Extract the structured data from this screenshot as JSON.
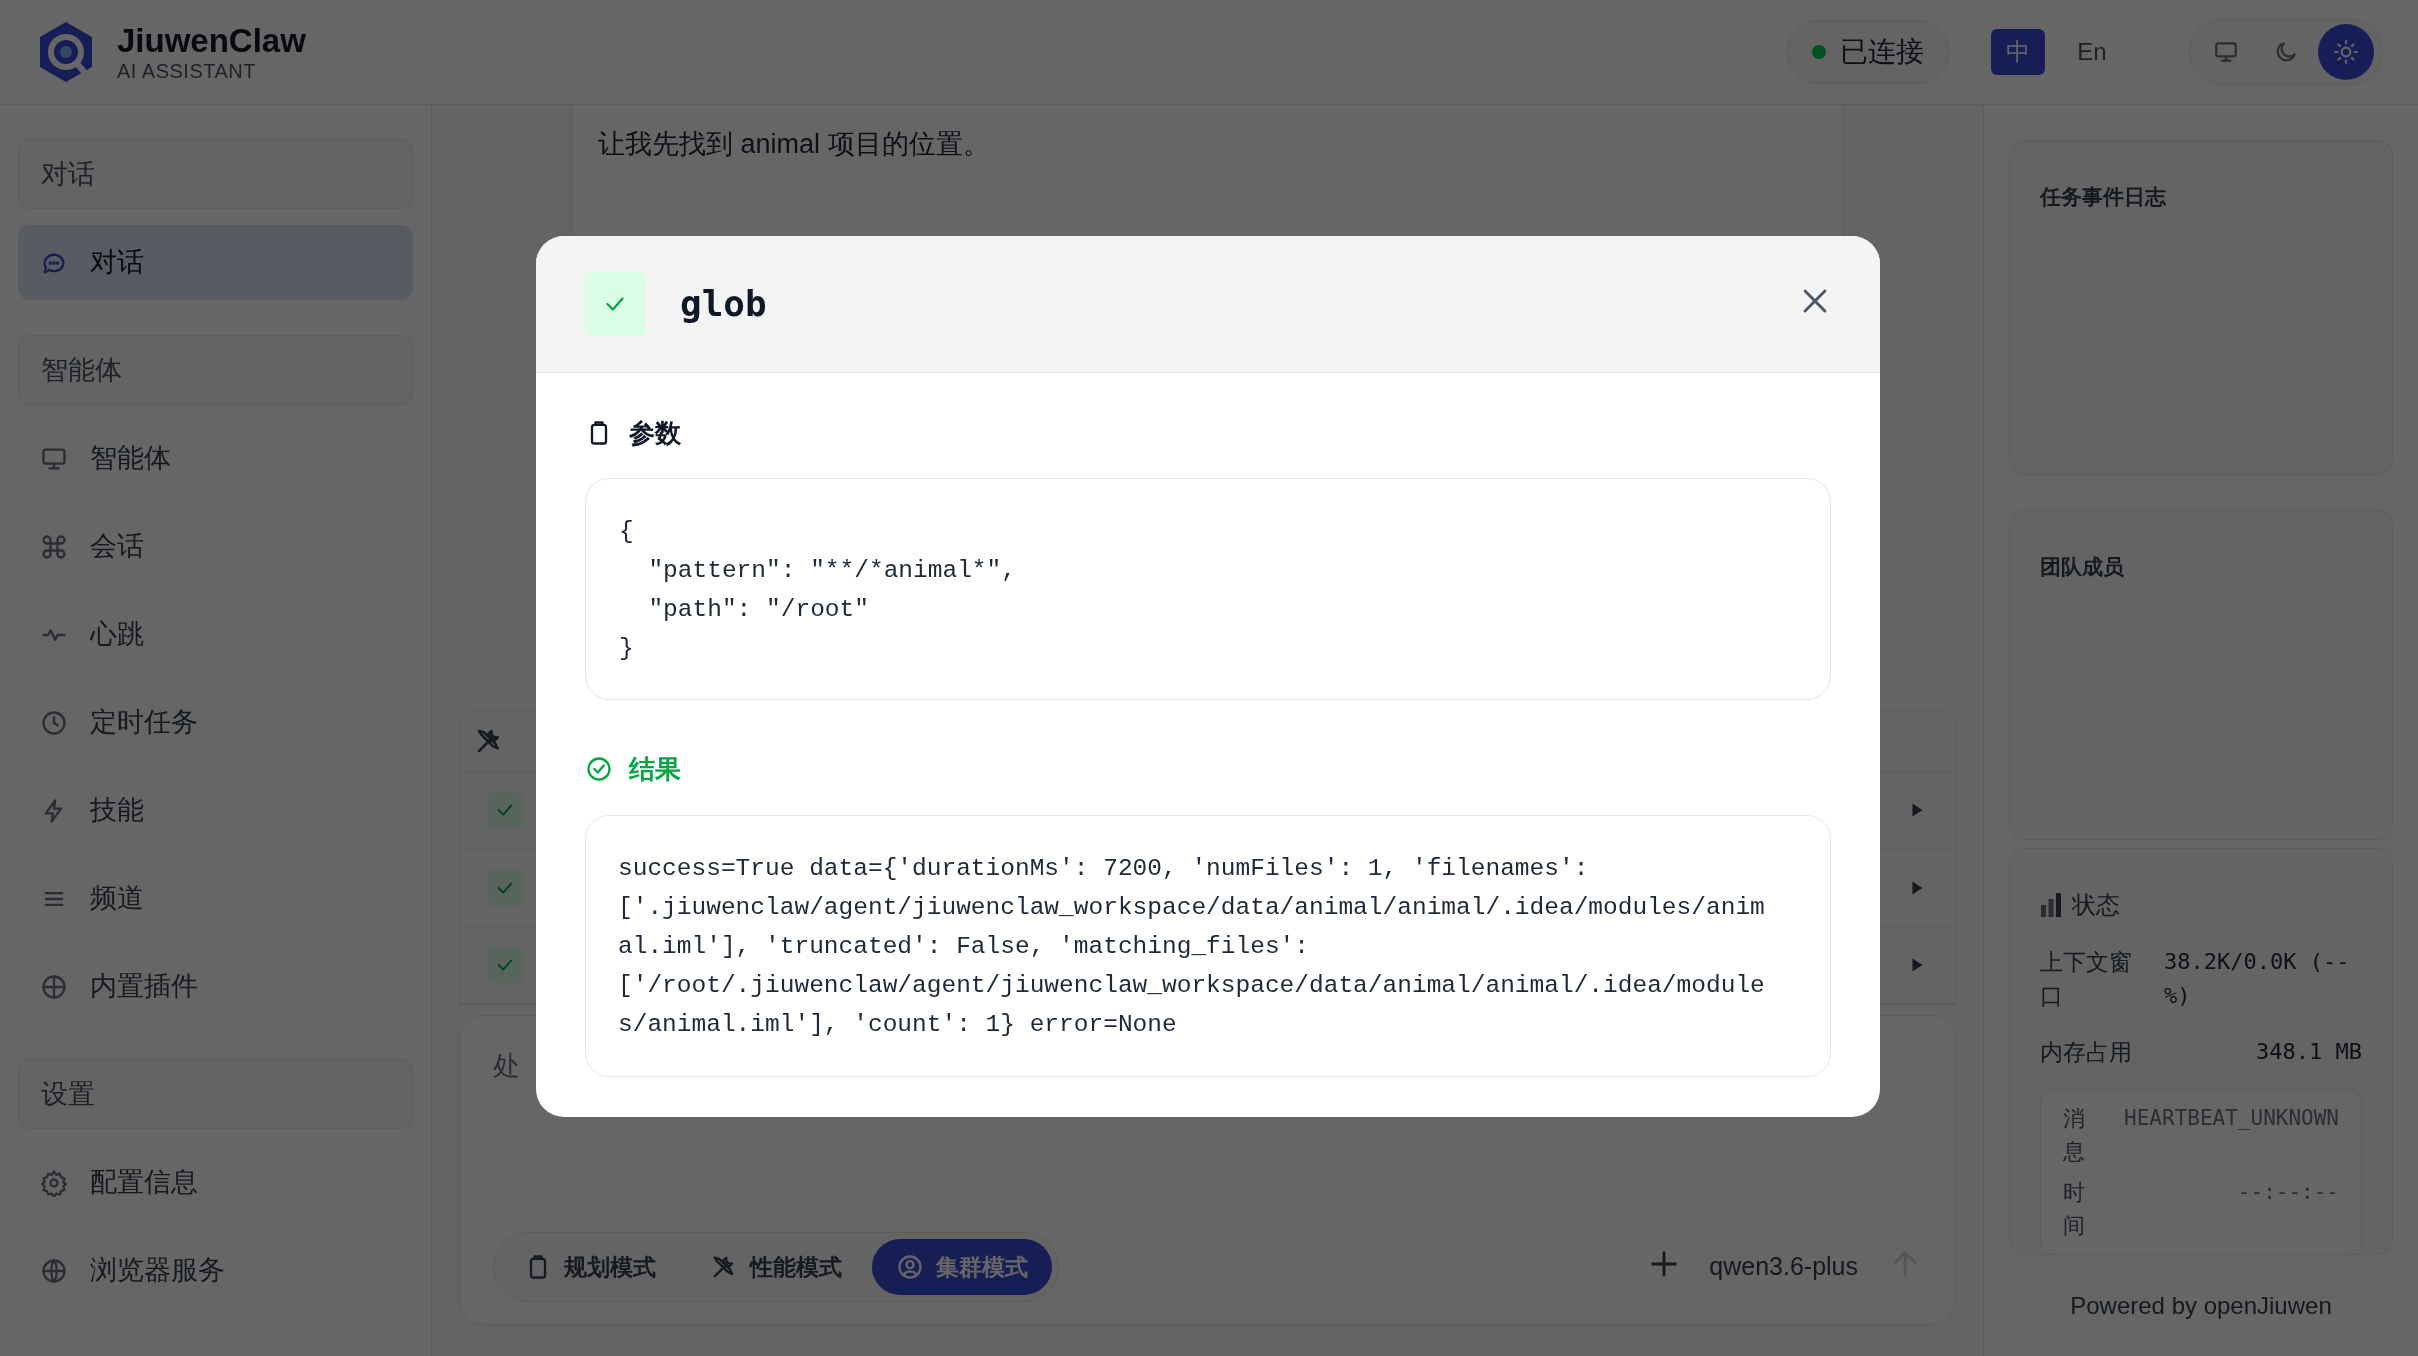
{
  "header": {
    "app_name": "JiuwenClaw",
    "app_subtitle": "AI ASSISTANT",
    "connection": {
      "label": "已连接",
      "connected": true
    },
    "languages": [
      {
        "label": "中",
        "selected": true
      },
      {
        "label": "En",
        "selected": false
      }
    ],
    "themes": [
      {
        "kind": "monitor",
        "selected": false
      },
      {
        "kind": "moon",
        "selected": false
      },
      {
        "kind": "sun",
        "selected": true
      }
    ]
  },
  "sidebar": {
    "sections": [
      {
        "title": "对话",
        "items": [
          {
            "label": "对话",
            "kind": "chat",
            "selected": true
          }
        ]
      },
      {
        "title": "智能体",
        "items": [
          {
            "label": "智能体",
            "kind": "monitor",
            "selected": false
          },
          {
            "label": "会话",
            "kind": "command",
            "selected": false
          },
          {
            "label": "心跳",
            "kind": "pulse",
            "selected": false
          },
          {
            "label": "定时任务",
            "kind": "clock",
            "selected": false
          },
          {
            "label": "技能",
            "kind": "bolt",
            "selected": false
          },
          {
            "label": "频道",
            "kind": "lines",
            "selected": false
          },
          {
            "label": "内置插件",
            "kind": "plus",
            "selected": false
          }
        ]
      },
      {
        "title": "设置",
        "items": [
          {
            "label": "配置信息",
            "kind": "gear",
            "selected": false
          },
          {
            "label": "浏览器服务",
            "kind": "globe",
            "selected": false
          }
        ]
      }
    ]
  },
  "chat": {
    "messages": [
      "让我先找到 animal 项目的位置。"
    ],
    "tool_calls": [
      {
        "done": true
      },
      {
        "done": true
      },
      {
        "done": true
      }
    ],
    "input": {
      "placeholder": "处"
    },
    "modes": [
      {
        "label": "规划模式",
        "kind": "clipboard",
        "selected": false
      },
      {
        "label": "性能模式",
        "kind": "tools",
        "selected": false
      },
      {
        "label": "集群模式",
        "kind": "cluster",
        "selected": true
      }
    ],
    "model": "qwen3.6-plus"
  },
  "right_panel": {
    "task_log_title": "任务事件日志",
    "team_title": "团队成员",
    "status": {
      "title": "状态",
      "rows": [
        {
          "label": "上下文窗口",
          "value": "38.2K/0.0K (--%)"
        },
        {
          "label": "内存占用",
          "value": "348.1 MB"
        }
      ],
      "heartbeat": [
        {
          "label": "消息",
          "value": "HEARTBEAT_UNKNOWN"
        },
        {
          "label": "时间",
          "value": "--:--:--"
        }
      ]
    },
    "footer": "Powered by openJiuwen"
  },
  "modal": {
    "title": "glob",
    "succeeded": true,
    "params_label": "参数",
    "params": "{\n  \"pattern\": \"**/*animal*\",\n  \"path\": \"/root\"\n}",
    "result_label": "结果",
    "result": "success=True data={'durationMs': 7200, 'numFiles': 1, 'filenames': ['.jiuwenclaw/agent/jiuwenclaw_workspace/data/animal/animal/.idea/modules/animal.iml'], 'truncated': False, 'matching_files': ['/root/.jiuwenclaw/agent/jiuwenclaw_workspace/data/animal/animal/.idea/modules/animal.iml'], 'count': 1} error=None"
  }
}
